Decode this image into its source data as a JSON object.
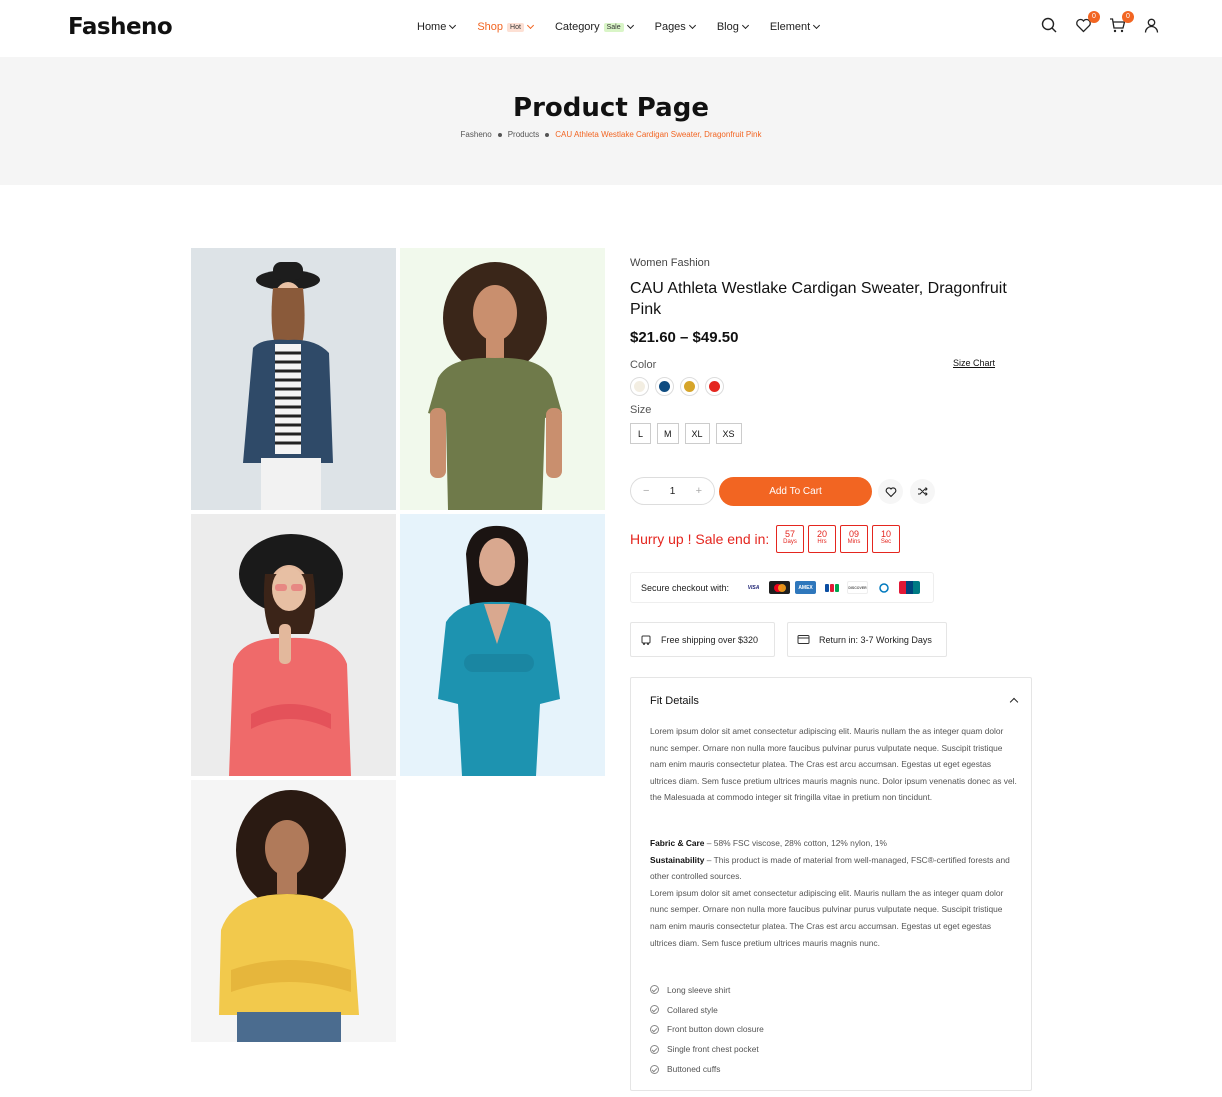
{
  "header": {
    "logo": "Fasheno",
    "nav": [
      {
        "label": "Home",
        "badge": ""
      },
      {
        "label": "Shop",
        "badge": "Hot"
      },
      {
        "label": "Category",
        "badge": "Sale"
      },
      {
        "label": "Pages",
        "badge": ""
      },
      {
        "label": "Blog",
        "badge": ""
      },
      {
        "label": "Element",
        "badge": ""
      }
    ],
    "wishlist_count": "0",
    "cart_count": "0"
  },
  "title_band": {
    "title": "Product Page",
    "breadcrumb": [
      "Fasheno",
      "Products",
      "CAU Athleta Westlake Cardigan Sweater, Dragonfruit Pink"
    ]
  },
  "product": {
    "category": "Women Fashion",
    "title": "CAU Athleta Westlake Cardigan Sweater, Dragonfruit Pink",
    "price": "$21.60 – $49.50",
    "color_label": "Color",
    "size_chart": "Size Chart",
    "colors": [
      "#f3eee2",
      "#0f4c81",
      "#d6a52a",
      "#e4261f"
    ],
    "size_label": "Size",
    "sizes": [
      "L",
      "M",
      "XL",
      "XS"
    ],
    "quantity": "1",
    "add_to_cart": "Add To Cart",
    "hurry": "Hurry up ! Sale end in:",
    "timer": [
      {
        "value": "57",
        "unit": "Days"
      },
      {
        "value": "20",
        "unit": "Hrs"
      },
      {
        "value": "09",
        "unit": "Mins"
      },
      {
        "value": "10",
        "unit": "Sec"
      }
    ],
    "secure_checkout": "Secure checkout with:",
    "payment_cards": [
      "VISA",
      "MC",
      "AMEX",
      "JCB",
      "DISCOVER",
      "DINERS",
      "UNIONPAY"
    ],
    "shipping": "Free shipping over $320",
    "returns": "Return in: 3-7 Working Days"
  },
  "fit": {
    "heading": "Fit Details",
    "para1": "Lorem ipsum dolor sit amet consectetur adipiscing elit. Mauris nullam the as integer quam dolor nunc semper. Ornare non nulla more faucibus pulvinar purus vulputate neque. Suscipit tristique nam enim mauris consectetur platea. The Cras est arcu accumsan. Egestas ut eget egestas ultrices diam. Sem fusce pretium ultrices mauris magnis nunc. Dolor ipsum venenatis donec as vel. the Malesuada at commodo integer sit fringilla vitae in pretium non tincidunt.",
    "fabric_label": "Fabric & Care",
    "fabric_text": " – 58% FSC viscose, 28% cotton, 12% nylon, 1%",
    "sustain_label": "Sustainability",
    "sustain_text": " – This product is made of material from well-managed, FSC®-certified forests and other controlled sources.",
    "para2": "Lorem ipsum dolor sit amet consectetur adipiscing elit. Mauris nullam the as integer quam dolor nunc semper. Ornare non nulla more faucibus pulvinar purus vulputate neque. Suscipit tristique nam enim mauris consectetur platea. The Cras est arcu accumsan. Egestas ut eget egestas ultrices diam. Sem fusce pretium ultrices mauris magnis nunc.",
    "features": [
      "Long sleeve shirt",
      "Collared style",
      "Front button down closure",
      "Single front chest pocket",
      "Buttoned cuffs"
    ]
  },
  "colors": {
    "accent": "#f26522",
    "sale_red": "#e4261f"
  }
}
